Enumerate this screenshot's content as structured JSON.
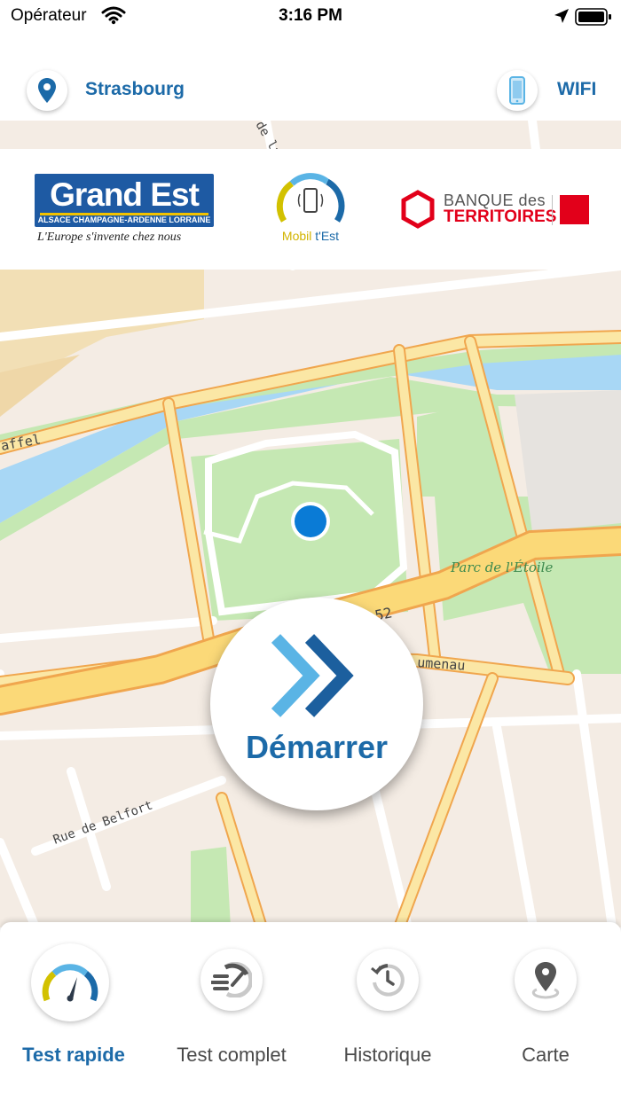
{
  "status_bar": {
    "carrier": "Opérateur",
    "time": "3:16 PM"
  },
  "location": {
    "city": "Strasbourg",
    "network": "WIFI"
  },
  "logos": {
    "grand_est_title": "Grand Est",
    "grand_est_subtitle": "ALSACE CHAMPAGNE-ARDENNE LORRAINE",
    "grand_est_tagline": "L'Europe s'invente chez nous",
    "mobil_a": "Mobil ",
    "mobil_b": "t'Est",
    "bdt_line1": "BANQUE des",
    "bdt_line2": "TERRITOIRES"
  },
  "map": {
    "labels": {
      "park": "Parc de l'Étoile",
      "street1": "Rue de Belfort",
      "street2": "affel",
      "street3": "umenau",
      "route": "52",
      "street4": "de la"
    }
  },
  "start_button": {
    "label": "Démarrer"
  },
  "tabs": [
    {
      "label": "Test rapide",
      "icon": "speedometer-icon",
      "active": true
    },
    {
      "label": "Test complet",
      "icon": "speed-lines-icon",
      "active": false
    },
    {
      "label": "Historique",
      "icon": "history-icon",
      "active": false
    },
    {
      "label": "Carte",
      "icon": "map-pin-icon",
      "active": false
    }
  ],
  "colors": {
    "brand_blue": "#1c6aa8",
    "light_blue": "#5ab4e5",
    "road_yellow": "#fbe7a5",
    "water": "#a8d7f5",
    "park": "#c5e8b3"
  }
}
